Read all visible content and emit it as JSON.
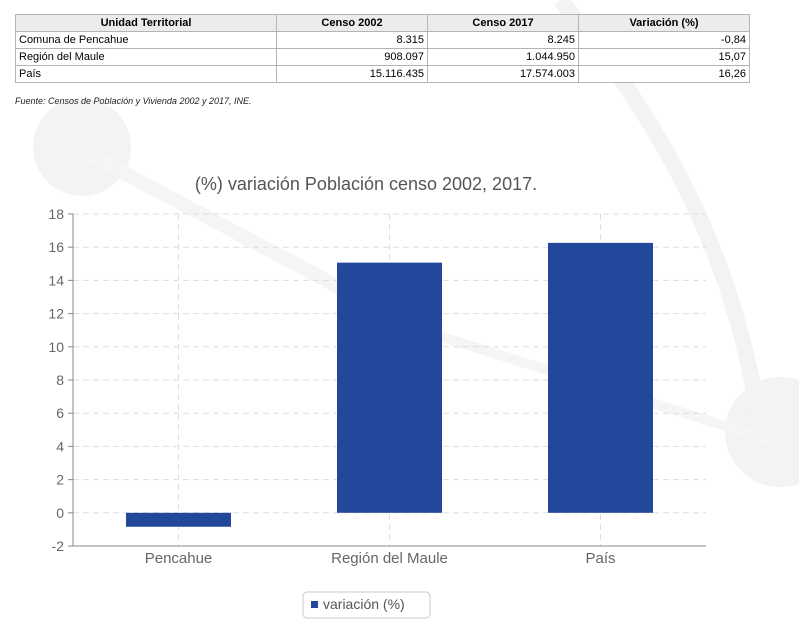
{
  "table": {
    "headers": [
      "Unidad Territorial",
      "Censo 2002",
      "Censo 2017",
      "Variación (%)"
    ],
    "rows": [
      [
        "Comuna de Pencahue",
        "8.315",
        "8.245",
        "-0,84"
      ],
      [
        "Región del Maule",
        "908.097",
        "1.044.950",
        "15,07"
      ],
      [
        "País",
        "15.116.435",
        "17.574.003",
        "16,26"
      ]
    ]
  },
  "source_note": "Fuente: Censos de Población y Vivienda 2002 y 2017, INE.",
  "chart_data": {
    "type": "bar",
    "title": "(%) variación Población censo 2002, 2017.",
    "categories": [
      "Pencahue",
      "Región del Maule",
      "País"
    ],
    "series": [
      {
        "name": "variación (%)",
        "values": [
          -0.84,
          15.07,
          16.26
        ],
        "color": "#23479b"
      }
    ],
    "ylim": [
      -2,
      18
    ],
    "yticks": [
      -2,
      0,
      2,
      4,
      6,
      8,
      10,
      12,
      14,
      16,
      18
    ],
    "grid": true,
    "legend_position": "bottom-center"
  },
  "colors": {
    "bar": "#23479b",
    "grid": "#dddddd",
    "axis_text": "#666666",
    "title_text": "#555555",
    "decoration": "#f3f3f3"
  }
}
